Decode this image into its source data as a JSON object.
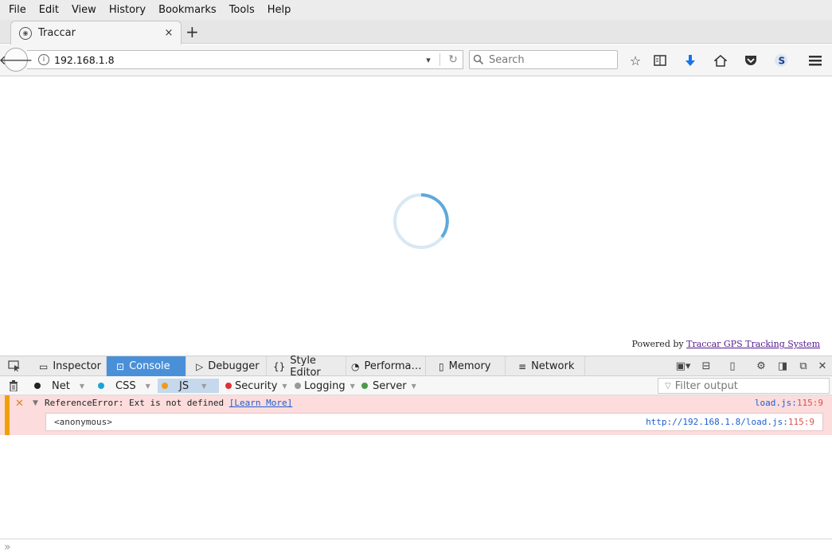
{
  "menu": [
    "File",
    "Edit",
    "View",
    "History",
    "Bookmarks",
    "Tools",
    "Help"
  ],
  "tab": {
    "title": "Traccar",
    "close": "×",
    "new": "+"
  },
  "nav": {
    "url": "192.168.1.8",
    "search_placeholder": "Search",
    "icons": [
      "bookmark-star-icon",
      "reading-list-icon",
      "download-icon",
      "home-icon",
      "pocket-icon",
      "extension-icon",
      "hamburger-menu-icon"
    ]
  },
  "page": {
    "powered_prefix": "Powered by ",
    "powered_link": "Traccar GPS Tracking System",
    "spinner_color": "#5fa8dc"
  },
  "devtools": {
    "tabs": [
      "Inspector",
      "Console",
      "Debugger",
      "Style Editor",
      "Performa…",
      "Memory",
      "Network"
    ],
    "active_tab": "Console",
    "filters": [
      {
        "label": "Net",
        "color": "#222222"
      },
      {
        "label": "CSS",
        "color": "#1aa5d8"
      },
      {
        "label": "JS",
        "color": "#f29a1a"
      },
      {
        "label": "Security",
        "color": "#e03131"
      },
      {
        "label": "Logging",
        "color": "#999999"
      },
      {
        "label": "Server",
        "color": "#4a9a4a"
      }
    ],
    "filter_placeholder": "Filter output",
    "error": {
      "message": "ReferenceError: Ext is not defined ",
      "learn_more": "[Learn More]",
      "location_file": "load.js:",
      "location_line": "115:9",
      "stack_function": "<anonymous>",
      "stack_location_file": "http://192.168.1.8/load.js:",
      "stack_location_line": "115:9"
    },
    "prompt": "»"
  }
}
